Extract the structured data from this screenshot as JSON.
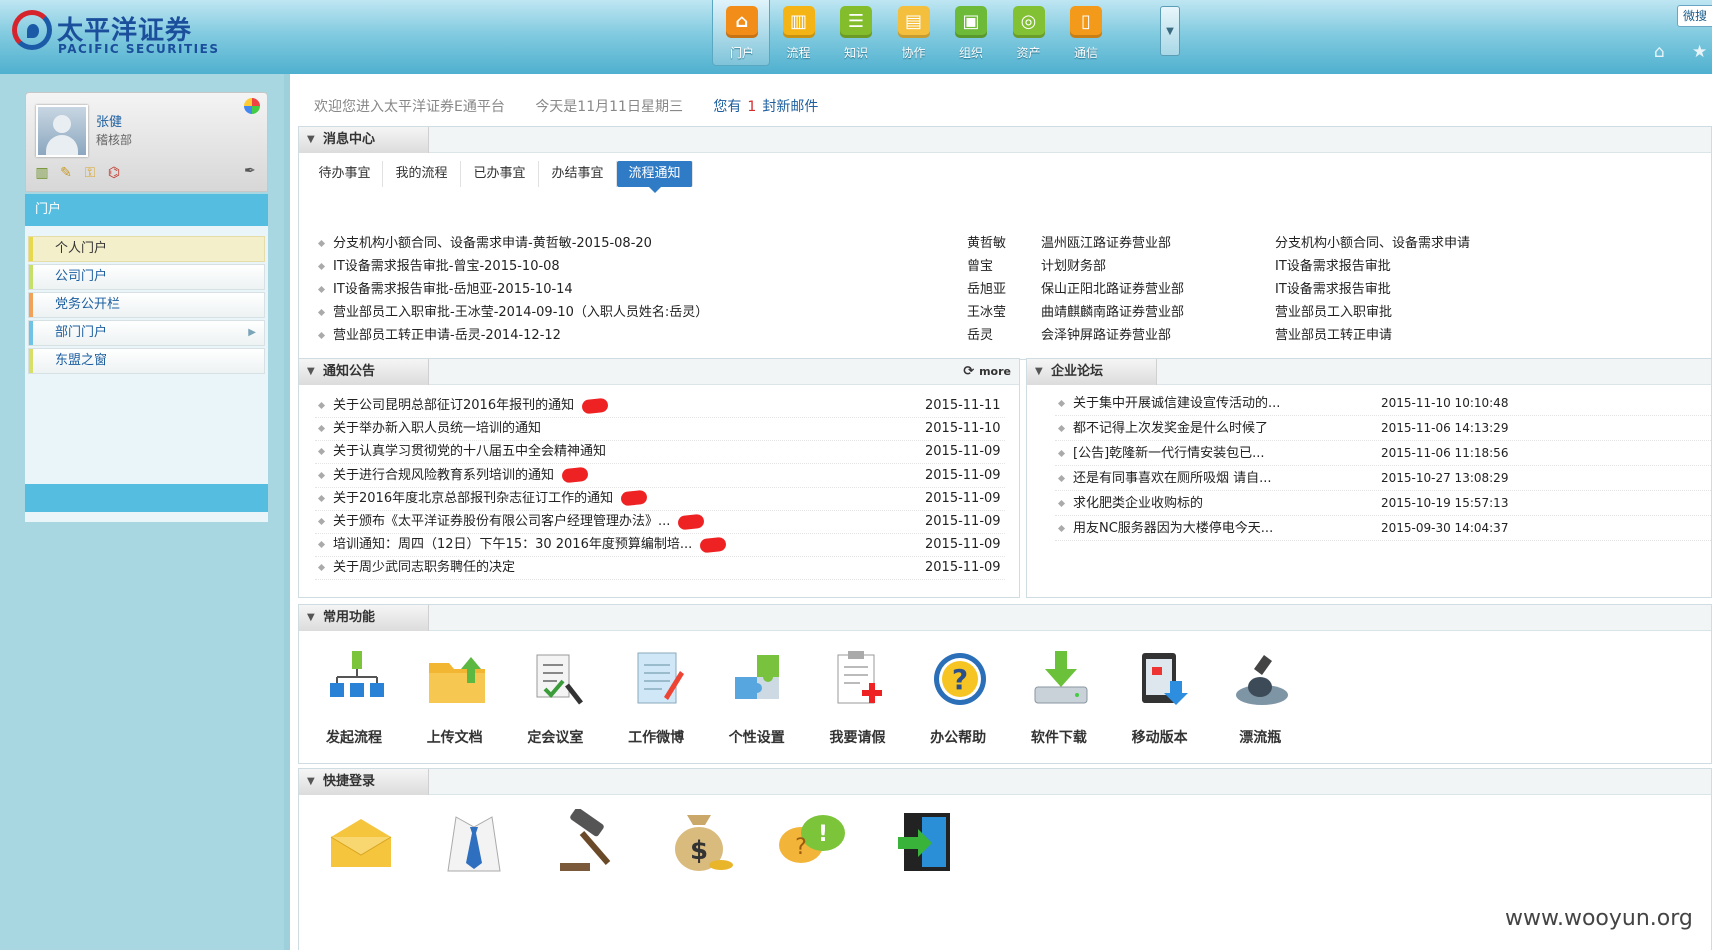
{
  "header": {
    "logo_cn": "太平洋证券",
    "logo_en": "PACIFIC SECURITIES",
    "nav": [
      {
        "label": "门户",
        "icon": "home-icon",
        "color": "#f28d1a",
        "glyph": "⌂"
      },
      {
        "label": "流程",
        "icon": "chart-icon",
        "color": "#f4b416",
        "glyph": "▥"
      },
      {
        "label": "知识",
        "icon": "list-icon",
        "color": "#83bd2c",
        "glyph": "☰"
      },
      {
        "label": "协作",
        "icon": "doc-icon",
        "color": "#f3bf3c",
        "glyph": "▤"
      },
      {
        "label": "组织",
        "icon": "printer-icon",
        "color": "#6cba38",
        "glyph": "▣"
      },
      {
        "label": "资产",
        "icon": "coins-icon",
        "color": "#82c034",
        "glyph": "◎"
      },
      {
        "label": "通信",
        "icon": "phone-icon",
        "color": "#f39a1a",
        "glyph": "▯"
      }
    ],
    "top_right_btn": "微搜"
  },
  "user": {
    "name": "张健",
    "dept": "稽核部"
  },
  "side_menu": {
    "title": "门户",
    "items": [
      {
        "label": "个人门户",
        "mark": "#e7d94d"
      },
      {
        "label": "公司门户",
        "mark": "#c6df6a"
      },
      {
        "label": "党务公开栏",
        "mark": "#f0a25a"
      },
      {
        "label": "部门门户",
        "mark": "#71c3e6"
      },
      {
        "label": "东盟之窗",
        "mark": "#d8df68"
      }
    ]
  },
  "welcome": {
    "text": "欢迎您进入太平洋证券E通平台",
    "date": "今天是11月11日星期三",
    "mail_pre": "您有",
    "mail_count": "1",
    "mail_post": "封新邮件"
  },
  "msg_center": {
    "title": "消息中心",
    "tabs": [
      "待办事宜",
      "我的流程",
      "已办事宜",
      "办结事宜",
      "流程通知"
    ],
    "rows": [
      {
        "title": "分支机构小额合同、设备需求申请-黄哲敏-2015-08-20",
        "person": "黄哲敏",
        "dept": "温州瓯江路证券营业部",
        "type": "分支机构小额合同、设备需求申请"
      },
      {
        "title": "IT设备需求报告审批-曾宝-2015-10-08",
        "person": "曾宝",
        "dept": "计划财务部",
        "type": "IT设备需求报告审批"
      },
      {
        "title": "IT设备需求报告审批-岳旭亚-2015-10-14",
        "person": "岳旭亚",
        "dept": "保山正阳北路证券营业部",
        "type": "IT设备需求报告审批"
      },
      {
        "title": "营业部员工入职审批-王冰莹-2014-09-10（入职人员姓名:岳灵）",
        "person": "王冰莹",
        "dept": "曲靖麒麟南路证券营业部",
        "type": "营业部员工入职审批"
      },
      {
        "title": "营业部员工转正申请-岳灵-2014-12-12",
        "person": "岳灵",
        "dept": "会泽钟屏路证券营业部",
        "type": "营业部员工转正申请"
      }
    ]
  },
  "notice": {
    "title": "通知公告",
    "more": "more",
    "rows": [
      {
        "title": "关于公司昆明总部征订2016年报刊的通知",
        "date": "2015-11-11",
        "new": true
      },
      {
        "title": "关于举办新入职人员统一培训的通知",
        "date": "2015-11-10",
        "new": false
      },
      {
        "title": "关于认真学习贯彻党的十八届五中全会精神通知",
        "date": "2015-11-09",
        "new": false
      },
      {
        "title": "关于进行合规风险教育系列培训的通知",
        "date": "2015-11-09",
        "new": true
      },
      {
        "title": "关于2016年度北京总部报刊杂志征订工作的通知",
        "date": "2015-11-09",
        "new": true
      },
      {
        "title": "关于颁布《太平洋证券股份有限公司客户经理管理办法》...",
        "date": "2015-11-09",
        "new": true
      },
      {
        "title": "培训通知：周四（12日）下午15：30 2016年度预算编制培...",
        "date": "2015-11-09",
        "new": true
      },
      {
        "title": "关于周少武同志职务聘任的决定",
        "date": "2015-11-09",
        "new": false
      }
    ]
  },
  "forum": {
    "title": "企业论坛",
    "rows": [
      {
        "title": "关于集中开展诚信建设宣传活动的...",
        "time": "2015-11-10 10:10:48"
      },
      {
        "title": "都不记得上次发奖金是什么时候了",
        "time": "2015-11-06 14:13:29"
      },
      {
        "title": "[公告]乾隆新一代行情安装包已...",
        "time": "2015-11-06 11:18:56"
      },
      {
        "title": "还是有同事喜欢在厕所吸烟 请自...",
        "time": "2015-10-27 13:08:29"
      },
      {
        "title": "求化肥类企业收购标的",
        "time": "2015-10-19 15:57:13"
      },
      {
        "title": "用友NC服务器因为大楼停电今天...",
        "time": "2015-09-30 14:04:37"
      }
    ]
  },
  "functions": {
    "title": "常用功能",
    "items": [
      {
        "label": "发起流程",
        "icon": "workflow-icon"
      },
      {
        "label": "上传文档",
        "icon": "upload-folder-icon"
      },
      {
        "label": "定会议室",
        "icon": "meeting-room-icon"
      },
      {
        "label": "工作微博",
        "icon": "notepad-icon"
      },
      {
        "label": "个性设置",
        "icon": "puzzle-icon"
      },
      {
        "label": "我要请假",
        "icon": "clipboard-leave-icon"
      },
      {
        "label": "办公帮助",
        "icon": "help-icon"
      },
      {
        "label": "软件下载",
        "icon": "download-icon"
      },
      {
        "label": "移动版本",
        "icon": "mobile-icon"
      },
      {
        "label": "漂流瓶",
        "icon": "bottle-icon"
      }
    ]
  },
  "quick": {
    "title": "快捷登录",
    "items": [
      {
        "icon": "mail-envelope-icon"
      },
      {
        "icon": "shirt-tie-icon"
      },
      {
        "icon": "gavel-icon"
      },
      {
        "icon": "money-bag-icon"
      },
      {
        "icon": "chat-bubbles-icon"
      },
      {
        "icon": "exit-door-icon"
      }
    ]
  },
  "watermark": "www.wooyun.org"
}
